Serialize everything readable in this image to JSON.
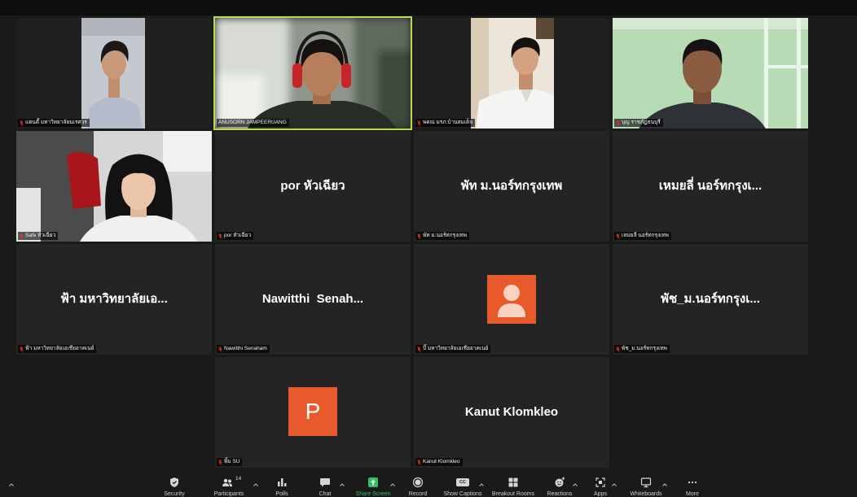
{
  "colors": {
    "page_bg": "#1a1a1a",
    "tile_bg": "#242424",
    "active_speaker_border": "#b5dc4b",
    "share_green": "#2fc25f",
    "avatar_orange": "#e85a2c",
    "muted_red": "#e0362c"
  },
  "tiles": [
    {
      "label": "แดนดี้ มหาวิทยาลัยนเรศวร",
      "muted": true,
      "camera_on": true
    },
    {
      "label": "ANUSORN JAMPEERUANG",
      "muted": false,
      "camera_on": true,
      "active_speaker": true
    },
    {
      "label": "พคณ มรภ.บ้านสมเด็จ",
      "muted": true,
      "camera_on": true
    },
    {
      "label": "บุญ ราชภัฏธนบุรี",
      "muted": true,
      "camera_on": true
    },
    {
      "label": "Safe หัวเฉียว",
      "muted": true,
      "camera_on": true
    },
    {
      "label": "por หัวเฉียว",
      "display_name": "por หัวเฉียว",
      "muted": true,
      "camera_on": false
    },
    {
      "label": "พัท ม.นอร์ทกรุงเทพ",
      "display_name": "พัท ม.นอร์ทกรุงเทพ",
      "muted": true,
      "camera_on": false
    },
    {
      "label": "เหมยลี่ นอร์ทกรุงเทพ",
      "display_name": "เหมยลี่ นอร์ทกรุงเ...",
      "muted": true,
      "camera_on": false
    },
    {
      "label": "ฟ้า มหาวิทยาลัยเอเชียอาคเนย์",
      "display_name": "ฟ้า มหาวิทยาลัยเอ...",
      "muted": true,
      "camera_on": false
    },
    {
      "label": "Nawitthi Senaham",
      "display_name": "Nawitthi  Senah...",
      "muted": true,
      "camera_on": false
    },
    {
      "label": "ปั๊ มหาวิทยาลัยเอเชียอาคเนย์",
      "avatar_icon": "person-icon",
      "muted": true,
      "camera_on": false
    },
    {
      "label": "พัช_ม.นอร์ทกรุงเทพ",
      "display_name": "พัช_ม.นอร์ทกรุงเ...",
      "muted": true,
      "camera_on": false
    },
    {
      "label": "พิ้ม SU",
      "initial": "P",
      "muted": true,
      "camera_on": false
    },
    {
      "label": "Kanut Klomkleo",
      "display_name": "Kanut Klomkleo",
      "muted": true,
      "camera_on": false
    }
  ],
  "toolbar": {
    "left_toggle_icon": "chevron-up-icon",
    "items": [
      {
        "label": "Security",
        "icon": "shield-icon",
        "caret": false
      },
      {
        "label": "Participants",
        "icon": "participants-icon",
        "count": "14",
        "caret": true
      },
      {
        "label": "Polls",
        "icon": "polls-icon",
        "caret": false
      },
      {
        "label": "Chat",
        "icon": "chat-icon",
        "caret": true
      },
      {
        "label": "Share Screen",
        "icon": "share-screen-icon",
        "caret": true
      },
      {
        "label": "Record",
        "icon": "record-icon",
        "caret": false
      },
      {
        "label": "Show Captions",
        "icon": "captions-icon",
        "icon_text": "CC",
        "caret": true
      },
      {
        "label": "Breakout Rooms",
        "icon": "breakout-rooms-icon",
        "caret": false
      },
      {
        "label": "Reactions",
        "icon": "reactions-icon",
        "caret": true
      },
      {
        "label": "Apps",
        "icon": "apps-icon",
        "caret": true
      },
      {
        "label": "Whiteboards",
        "icon": "whiteboards-icon",
        "caret": true
      },
      {
        "label": "More",
        "icon": "more-icon",
        "caret": false
      }
    ]
  }
}
